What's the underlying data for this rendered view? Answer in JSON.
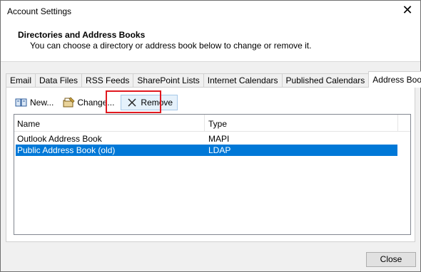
{
  "window": {
    "title": "Account Settings"
  },
  "header": {
    "title": "Directories and Address Books",
    "subtitle": "You can choose a directory or address book below to change or remove it."
  },
  "tabs": [
    {
      "label": "Email"
    },
    {
      "label": "Data Files"
    },
    {
      "label": "RSS Feeds"
    },
    {
      "label": "SharePoint Lists"
    },
    {
      "label": "Internet Calendars"
    },
    {
      "label": "Published Calendars"
    },
    {
      "label": "Address Books",
      "active": true
    }
  ],
  "toolbar": {
    "new_label": "New...",
    "change_label": "Change...",
    "remove_label": "Remove"
  },
  "list": {
    "columns": [
      "Name",
      "Type"
    ],
    "rows": [
      {
        "name": "Outlook Address Book",
        "type": "MAPI",
        "selected": false
      },
      {
        "name": "Public Address Book (old)",
        "type": "LDAP",
        "selected": true
      }
    ]
  },
  "footer": {
    "close_label": "Close"
  },
  "colors": {
    "selection": "#0078d7",
    "highlight": "#e0181f"
  }
}
